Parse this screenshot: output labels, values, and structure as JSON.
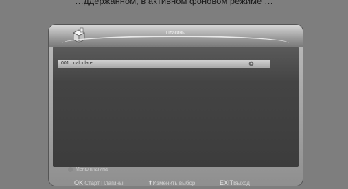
{
  "caption": "…ддержанном, в активном фоновом режиме …",
  "window": {
    "title": "Плагины",
    "logo_icon": "plugin-box-icon"
  },
  "list": {
    "items": [
      {
        "number": "001",
        "name": "calculate",
        "icon": "settings-circle-icon"
      }
    ]
  },
  "hint": {
    "label": "Меню плагина"
  },
  "footer": {
    "ok_key": "OK",
    "ok_label": "Старт Плагины",
    "nav_key": "⬍",
    "nav_label": "Изменить выбор",
    "exit_key": "EXIT",
    "exit_label": "Выход"
  }
}
